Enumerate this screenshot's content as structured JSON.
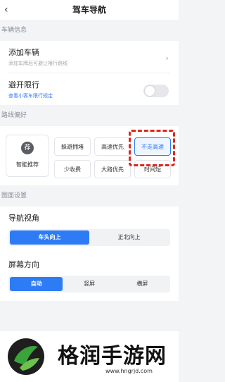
{
  "header": {
    "back_icon": "chevron-left-icon",
    "title": "驾车导航"
  },
  "vehicle": {
    "section_title": "车辆信息",
    "add_title": "添加车辆",
    "add_sub": "添加车牌后可避让限行路线",
    "avoid_title": "避开限行",
    "avoid_link": "查看小客车限行规定",
    "avoid_enabled": false
  },
  "route": {
    "section_title": "路线偏好",
    "smart": {
      "icon_char": "荐",
      "label": "智能推荐"
    },
    "options": [
      "躲避拥堵",
      "高速优先",
      "不走高速",
      "少收费",
      "大路优先",
      "时间短"
    ],
    "selected": "不走高速"
  },
  "screen": {
    "section_title": "图面设置",
    "view_label": "导航视角",
    "view_options": [
      "车头向上",
      "正北向上"
    ],
    "view_selected": "车头向上",
    "orient_label": "屏幕方向",
    "orient_options": [
      "自动",
      "竖屏",
      "横屏"
    ],
    "orient_selected": "自动"
  },
  "watermark": {
    "brand": "格润手游网",
    "url": "www.hngrjd.com"
  },
  "colors": {
    "accent": "#2e7bf6",
    "highlight_border": "#e0261c"
  }
}
